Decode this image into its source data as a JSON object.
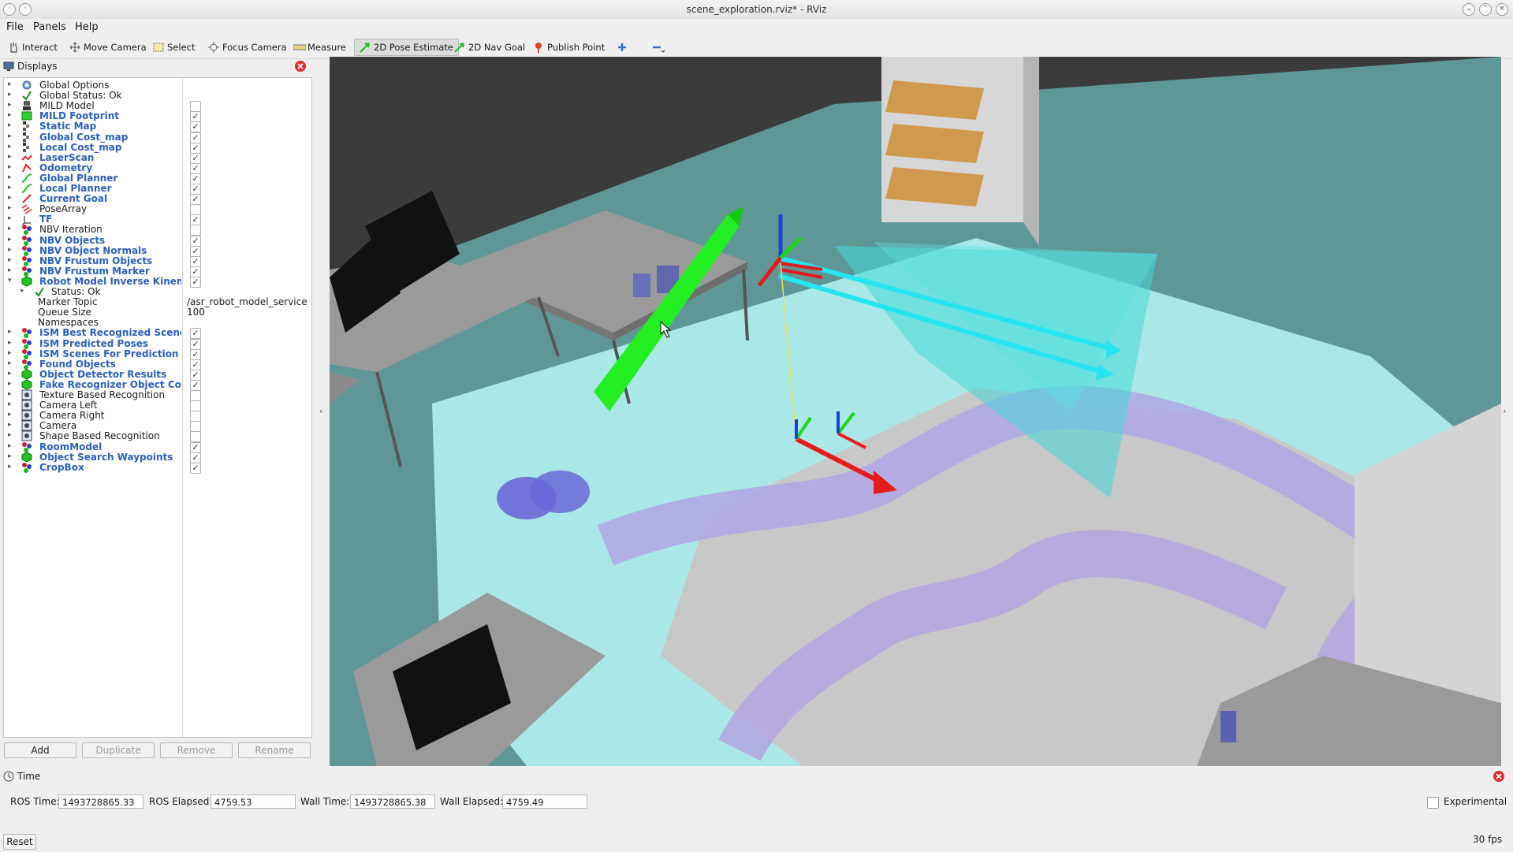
{
  "window": {
    "title": "scene_exploration.rviz* - RViz"
  },
  "menu": [
    "File",
    "Panels",
    "Help"
  ],
  "toolbar": [
    {
      "label": "Interact",
      "icon": "hand-icon"
    },
    {
      "label": "Move Camera",
      "icon": "move-icon"
    },
    {
      "label": "Select",
      "icon": "select-icon"
    },
    {
      "label": "Focus Camera",
      "icon": "focus-icon"
    },
    {
      "label": "Measure",
      "icon": "ruler-icon"
    },
    {
      "label": "2D Pose Estimate",
      "icon": "green-arrow-icon"
    },
    {
      "label": "2D Nav Goal",
      "icon": "green-arrow-icon"
    },
    {
      "label": "Publish Point",
      "icon": "pin-icon"
    }
  ],
  "displays": {
    "title": "Displays",
    "items": [
      {
        "label": "Global Options",
        "blue": false,
        "checked": null,
        "icon": "gear-icon"
      },
      {
        "label": "Global Status: Ok",
        "blue": false,
        "checked": null,
        "icon": "check-icon"
      },
      {
        "label": "MILD Model",
        "blue": false,
        "checked": false,
        "icon": "robot-icon"
      },
      {
        "label": "MILD Footprint",
        "blue": true,
        "checked": true,
        "icon": "footprint-icon"
      },
      {
        "label": "Static Map",
        "blue": true,
        "checked": true,
        "icon": "map-icon"
      },
      {
        "label": "Global Cost_map",
        "blue": true,
        "checked": true,
        "icon": "map-icon"
      },
      {
        "label": "Local Cost_map",
        "blue": true,
        "checked": true,
        "icon": "map-icon"
      },
      {
        "label": "LaserScan",
        "blue": true,
        "checked": true,
        "icon": "laser-icon"
      },
      {
        "label": "Odometry",
        "blue": true,
        "checked": true,
        "icon": "odometry-icon"
      },
      {
        "label": "Global Planner",
        "blue": true,
        "checked": true,
        "icon": "path-icon"
      },
      {
        "label": "Local Planner",
        "blue": true,
        "checked": true,
        "icon": "path-icon"
      },
      {
        "label": "Current Goal",
        "blue": true,
        "checked": true,
        "icon": "pose-icon"
      },
      {
        "label": "PoseArray",
        "blue": false,
        "checked": false,
        "icon": "posearray-icon"
      },
      {
        "label": "TF",
        "blue": true,
        "checked": true,
        "icon": "tf-icon"
      },
      {
        "label": "NBV Iteration",
        "blue": false,
        "checked": false,
        "icon": "marker-icon"
      },
      {
        "label": "NBV Objects",
        "blue": true,
        "checked": true,
        "icon": "marker-icon"
      },
      {
        "label": "NBV Object Normals",
        "blue": true,
        "checked": true,
        "icon": "marker-icon"
      },
      {
        "label": "NBV Frustum Objects",
        "blue": true,
        "checked": true,
        "icon": "marker-icon"
      },
      {
        "label": "NBV Frustum Marker",
        "blue": true,
        "checked": true,
        "icon": "marker-icon"
      },
      {
        "label": "Robot Model Inverse Kinema...",
        "blue": true,
        "checked": true,
        "icon": "cube-icon",
        "expanded": true
      },
      {
        "label": "Status: Ok",
        "blue": false,
        "checked": null,
        "icon": "check-icon",
        "child": true
      },
      {
        "label": "Marker Topic",
        "blue": false,
        "checked": null,
        "icon": null,
        "child": true,
        "value": "/asr_robot_model_service..."
      },
      {
        "label": "Queue Size",
        "blue": false,
        "checked": null,
        "icon": null,
        "child": true,
        "value": "100"
      },
      {
        "label": "Namespaces",
        "blue": false,
        "checked": null,
        "icon": null,
        "child": true,
        "value": ""
      },
      {
        "label": "ISM Best Recognized Scenes",
        "blue": true,
        "checked": true,
        "icon": "marker-icon"
      },
      {
        "label": "ISM Predicted Poses",
        "blue": true,
        "checked": true,
        "icon": "marker-icon"
      },
      {
        "label": "ISM Scenes For Prediction",
        "blue": true,
        "checked": true,
        "icon": "marker-icon"
      },
      {
        "label": "Found Objects",
        "blue": true,
        "checked": true,
        "icon": "marker-icon"
      },
      {
        "label": "Object Detector Results",
        "blue": true,
        "checked": true,
        "icon": "cube-icon"
      },
      {
        "label": "Fake Recognizer Object Cons...",
        "blue": true,
        "checked": true,
        "icon": "cube-icon"
      },
      {
        "label": "Texture Based Recognition",
        "blue": false,
        "checked": false,
        "icon": "camera-icon"
      },
      {
        "label": "Camera Left",
        "blue": false,
        "checked": false,
        "icon": "camera-icon"
      },
      {
        "label": "Camera Right",
        "blue": false,
        "checked": false,
        "icon": "camera-icon"
      },
      {
        "label": "Camera",
        "blue": false,
        "checked": false,
        "icon": "camera-icon"
      },
      {
        "label": "Shape Based Recognition",
        "blue": false,
        "checked": false,
        "icon": "camera-icon"
      },
      {
        "label": "RoomModel",
        "blue": true,
        "checked": true,
        "icon": "marker-icon"
      },
      {
        "label": "Object Search Waypoints",
        "blue": true,
        "checked": true,
        "icon": "cube-icon"
      },
      {
        "label": "CropBox",
        "blue": true,
        "checked": true,
        "icon": "marker-icon"
      }
    ],
    "buttons": [
      {
        "label": "Add",
        "enabled": true
      },
      {
        "label": "Duplicate",
        "enabled": false
      },
      {
        "label": "Remove",
        "enabled": false
      },
      {
        "label": "Rename",
        "enabled": false
      }
    ]
  },
  "time": {
    "title": "Time",
    "ros_time_label": "ROS Time:",
    "ros_time": "1493728865.33",
    "ros_elapsed_label": "ROS Elapsed:",
    "ros_elapsed": "4759.53",
    "wall_time_label": "Wall Time:",
    "wall_time": "1493728865.38",
    "wall_elapsed_label": "Wall Elapsed:",
    "wall_elapsed": "4759.49",
    "experimental_label": "Experimental"
  },
  "status": {
    "reset_label": "Reset",
    "fps": "30 fps"
  },
  "colors": {
    "accent_blue": "#2a60b8",
    "costmap_cyan": "#a9e8e6",
    "path_green": "#22ee22",
    "frustum_cyan": "#44d8d8"
  }
}
